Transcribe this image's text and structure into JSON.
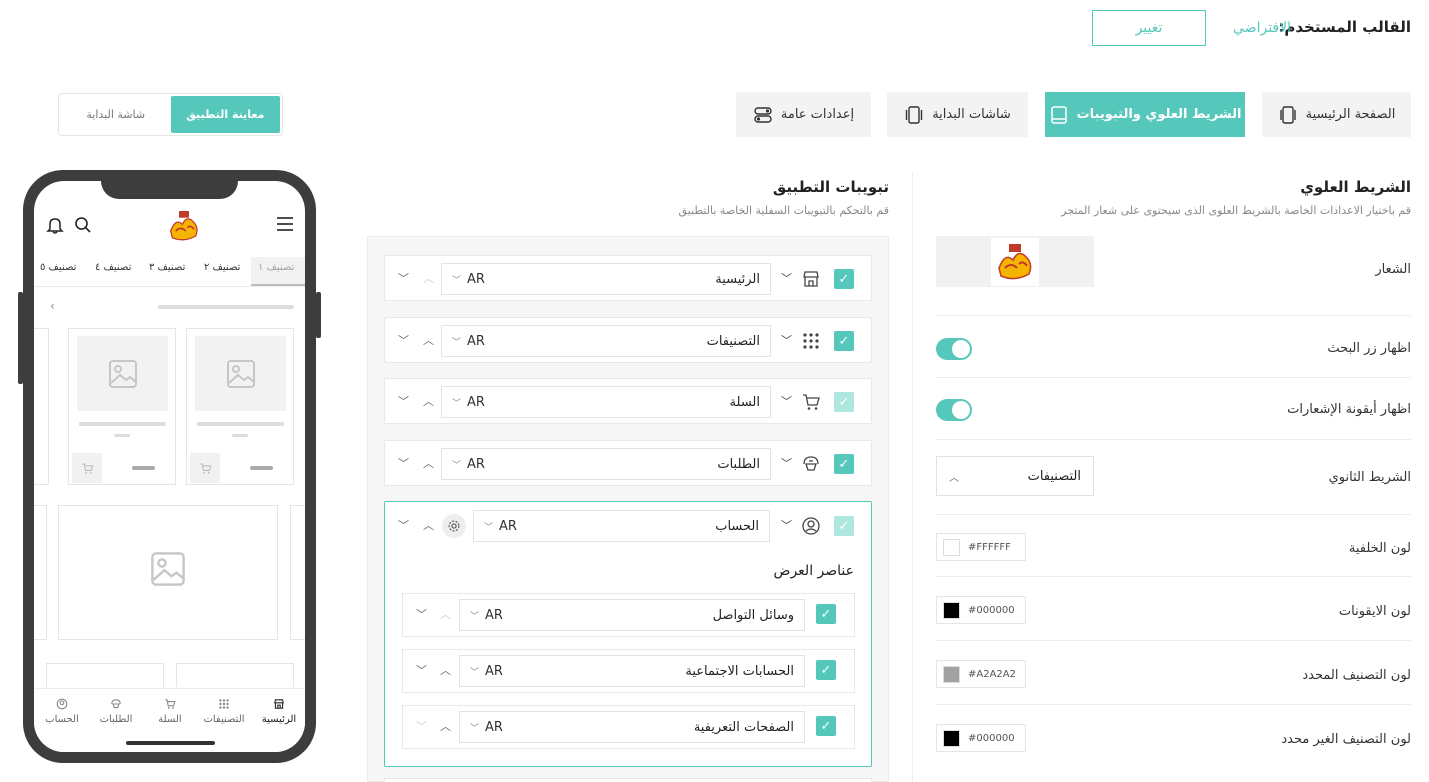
{
  "template": {
    "label": "القالب المستخدم:",
    "value": "الافتراضي",
    "change_button": "تغيير"
  },
  "tabs": [
    {
      "label": "الصفحة الرئيسية",
      "icon": "phone-icon",
      "active": false
    },
    {
      "label": "الشريط العلوي والتبويبات",
      "icon": "tablet-icon",
      "active": true
    },
    {
      "label": "شاشات البداية",
      "icon": "slides-icon",
      "active": false
    },
    {
      "label": "إعدادات عامة",
      "icon": "toggles-icon",
      "active": false
    }
  ],
  "preview_toggle": {
    "app_preview": "معاينة التطبيق",
    "splash_screen": "شاشة البداية"
  },
  "top_bar": {
    "title": "الشريط العلوي",
    "subtitle": "قم باختيار الاعدادات الخاصة بالشريط العلوى الذى سيحتوى على شعار المتجر",
    "logo_label": "الشعار",
    "show_search_label": "اظهار زر البحث",
    "show_notifications_label": "اظهار أيقونة الإشعارات",
    "secondary_bar_label": "الشريط الثانوي",
    "secondary_bar_value": "التصنيفات",
    "colors": [
      {
        "label": "لون الخلفية",
        "hex": "#FFFFFF"
      },
      {
        "label": "لون الايقونات",
        "hex": "#000000"
      },
      {
        "label": "لون التصنيف المحدد",
        "hex": "#A2A2A2"
      },
      {
        "label": "لون التصنيف الغير محدد",
        "hex": "#000000"
      }
    ]
  },
  "app_tabs": {
    "title": "تبويبات التطبيق",
    "subtitle": "قم بالتحكم بالتبويبات السفلية الخاصة بالتطبيق",
    "lang": "AR",
    "items": [
      {
        "label": "الرئيسية",
        "icon": "store-icon"
      },
      {
        "label": "التصنيفات",
        "icon": "grid-icon"
      },
      {
        "label": "السلة",
        "icon": "cart-icon"
      },
      {
        "label": "الطلبات",
        "icon": "orders-icon"
      },
      {
        "label": "الحساب",
        "icon": "user-icon"
      }
    ],
    "display_elements_title": "عناصر العرض",
    "display_elements": [
      {
        "label": "وسائل التواصل"
      },
      {
        "label": "الحسابات الاجتماعية"
      },
      {
        "label": "الصفحات التعريفية"
      }
    ]
  },
  "phone": {
    "categories": [
      "تصنيف ١",
      "تصنيف ٢",
      "تصنيف ٣",
      "تصنيف ٤",
      "تصنيف ٥"
    ],
    "bottom_tabs": [
      "الرئيسية",
      "التصنيفات",
      "السلة",
      "الطلبات",
      "الحساب"
    ]
  },
  "colors": {
    "accent": "#56c7bb",
    "accent_light": "#aee6e0"
  }
}
